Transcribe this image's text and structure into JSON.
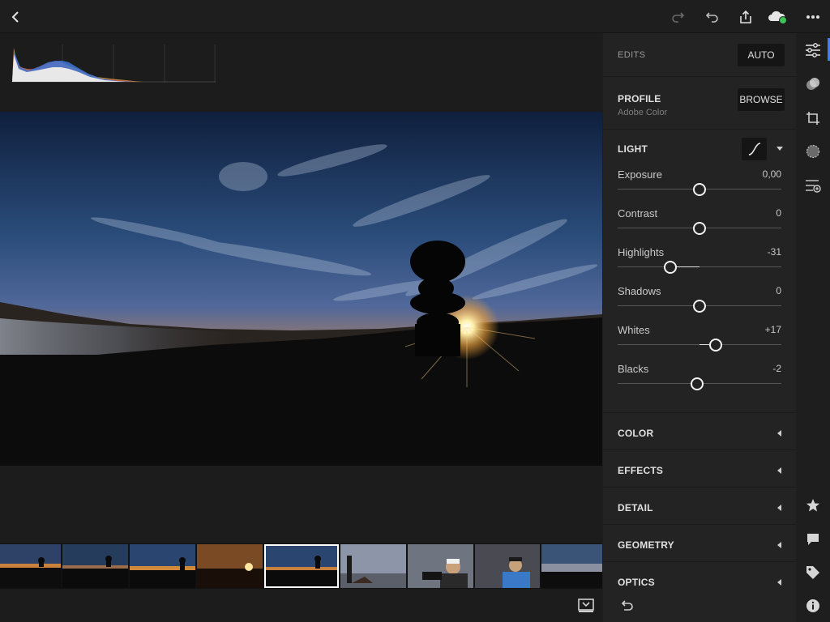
{
  "toolbar": {
    "back": "chevron-left-icon",
    "redo": "redo-icon",
    "undo": "undo-icon",
    "share": "share-icon",
    "cloud": "cloud-sync-icon",
    "more": "more-icon",
    "cloud_status_color": "#3cc35a"
  },
  "edits": {
    "header": "EDITS",
    "auto_label": "AUTO",
    "profile_title": "PROFILE",
    "profile_value": "Adobe Color",
    "browse_label": "BROWSE",
    "light_title": "LIGHT"
  },
  "light_sliders": [
    {
      "name": "Exposure",
      "value": "0,00",
      "level": 0.5
    },
    {
      "name": "Contrast",
      "value": "0",
      "level": 0.5
    },
    {
      "name": "Highlights",
      "value": "-31",
      "level": 0.32
    },
    {
      "name": "Shadows",
      "value": "0",
      "level": 0.5
    },
    {
      "name": "Whites",
      "value": "+17",
      "level": 0.6
    },
    {
      "name": "Blacks",
      "value": "-2",
      "level": 0.485
    }
  ],
  "sections": [
    "COLOR",
    "EFFECTS",
    "DETAIL",
    "GEOMETRY",
    "OPTICS"
  ],
  "rail": {
    "accent": "#3d7ef5",
    "top_icons": [
      "sliders-icon",
      "presets-icon",
      "crop-icon",
      "selective-icon",
      "healing-icon"
    ],
    "bottom_icons": [
      "star-icon",
      "comment-icon",
      "tag-icon",
      "info-icon"
    ]
  },
  "filmstrip": {
    "count": 9,
    "selected_index": 4
  }
}
